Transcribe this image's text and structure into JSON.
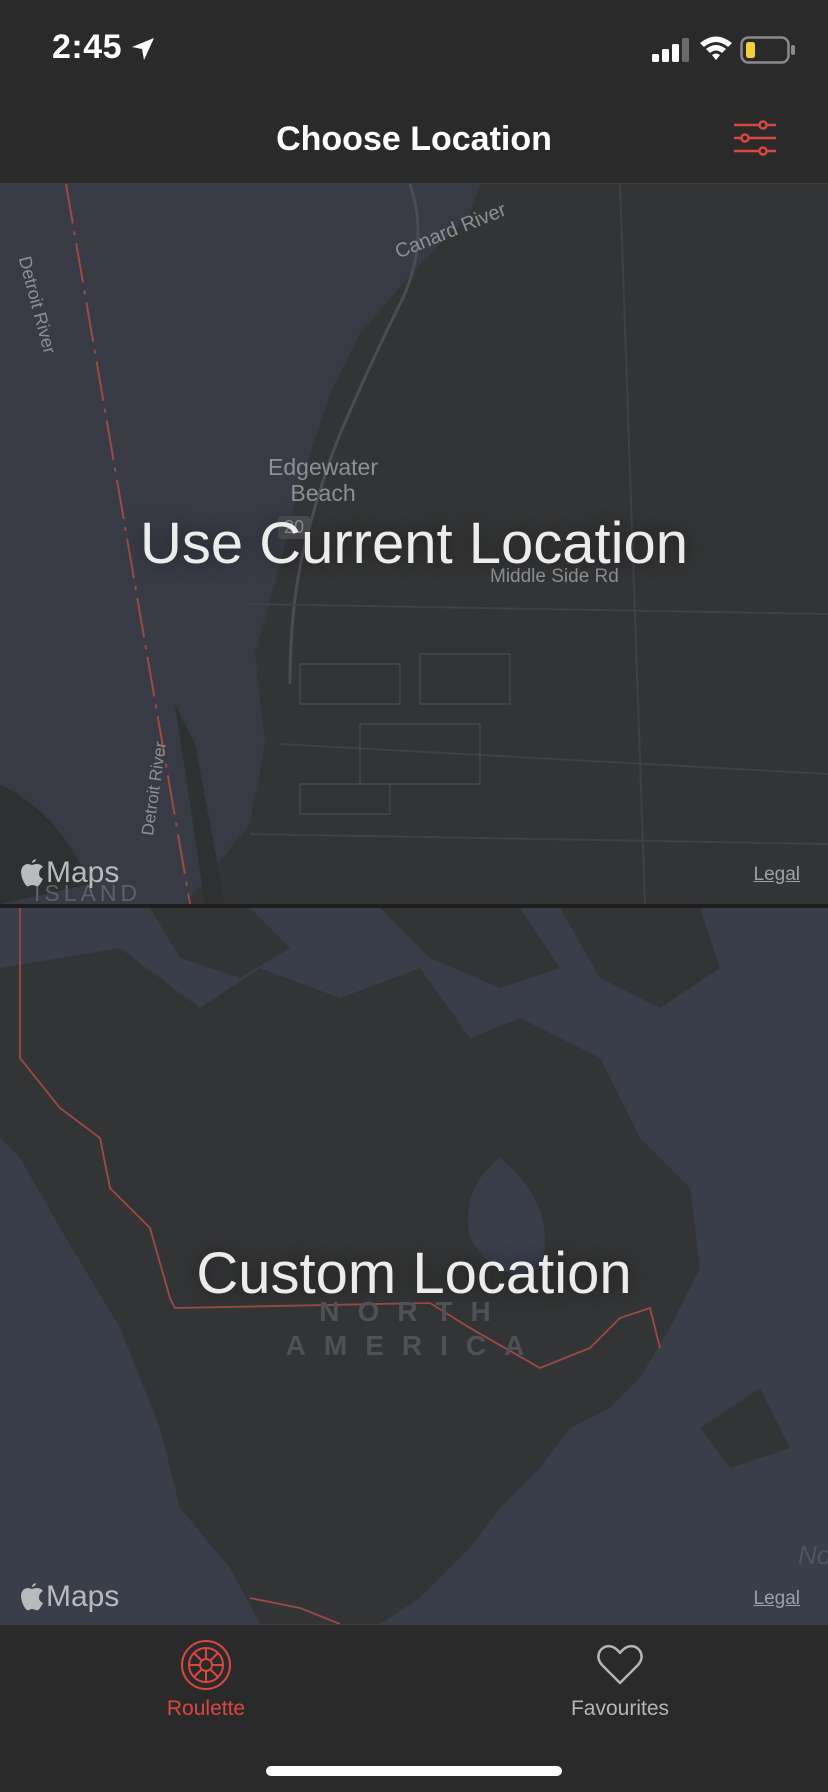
{
  "status_bar": {
    "time": "2:45",
    "icons": [
      "location-arrow-icon",
      "cellular-signal-icon",
      "wifi-icon",
      "battery-low-icon"
    ]
  },
  "nav": {
    "title": "Choose Location",
    "filter_icon": "sliders-icon"
  },
  "current_location_panel": {
    "label": "Use Current Location",
    "map_labels": {
      "river_top": "Detroit River",
      "canard": "Canard River",
      "town": "Edgewater Beach",
      "road": "Middle Side Rd",
      "river_bottom": "Detroit River",
      "island": "ISLAND",
      "route_shield": "20"
    },
    "attribution": "Maps",
    "legal": "Legal"
  },
  "custom_location_panel": {
    "label": "Custom Location",
    "map_labels": {
      "continent_line1": "NORTH",
      "continent_line2": "AMERICA",
      "edge_text": "No"
    },
    "attribution": "Maps",
    "legal": "Legal"
  },
  "tab_bar": {
    "tabs": [
      {
        "label": "Roulette",
        "icon": "roulette-wheel-icon",
        "active": true
      },
      {
        "label": "Favourites",
        "icon": "heart-icon",
        "active": false
      }
    ]
  },
  "colors": {
    "accent": "#d9473f",
    "background": "#2a2a2b",
    "map_water": "#383b46",
    "map_land": "#333435",
    "inactive_tab": "#b5b5b8"
  }
}
